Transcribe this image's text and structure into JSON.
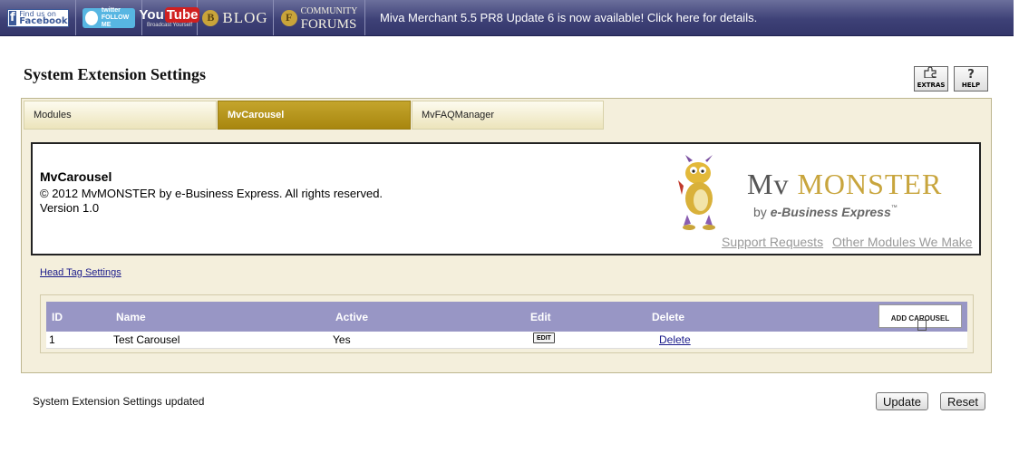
{
  "topbar": {
    "facebook": {
      "line1": "Find us on",
      "line2": "Facebook"
    },
    "twitter": {
      "line1": "twitter",
      "line2": "FOLLOW ME"
    },
    "youtube": {
      "you": "You",
      "tube": "Tube",
      "tagline": "Broadcast Yourself"
    },
    "blog": {
      "letter": "B",
      "label": "BLOG"
    },
    "forums": {
      "letter": "F",
      "line1": "COMMUNITY",
      "line2": "FORUMS"
    },
    "announcement": "Miva Merchant 5.5 PR8 Update 6 is now available! Click here for details."
  },
  "header": {
    "title": "System Extension Settings",
    "extras_label": "EXTRAS",
    "help_label": "HELP",
    "help_glyph": "?"
  },
  "tabs": [
    {
      "label": "Modules",
      "active": false
    },
    {
      "label": "MvCarousel",
      "active": true
    },
    {
      "label": "MvFAQManager",
      "active": false
    }
  ],
  "module_info": {
    "name": "MvCarousel",
    "copyright": "© 2012 MvMONSTER by e-Business Express. All rights reserved.",
    "version": "Version 1.0",
    "logo": {
      "mv": "Mv",
      "monster": "MONSTER",
      "by": "by",
      "ebusiness": "e-Business Express",
      "tm": "™"
    },
    "support_link": "Support Requests",
    "other_link": "Other Modules We Make"
  },
  "head_tag_link": "Head Tag Settings",
  "table": {
    "columns": {
      "id": "ID",
      "name": "Name",
      "active": "Active",
      "edit": "Edit",
      "delete": "Delete"
    },
    "add_button": "ADD CAROUSEL",
    "rows": [
      {
        "id": "1",
        "name": "Test Carousel",
        "active": "Yes",
        "edit": "EDIT",
        "delete": "Delete"
      }
    ]
  },
  "footer": {
    "status": "System Extension Settings updated",
    "update_label": "Update",
    "reset_label": "Reset"
  },
  "colors": {
    "topbar": "#3e4177",
    "tab_active": "#b8961c",
    "panel_bg": "#f4efdc",
    "table_header": "#9896c5",
    "logo_gold": "#c8a53d"
  }
}
